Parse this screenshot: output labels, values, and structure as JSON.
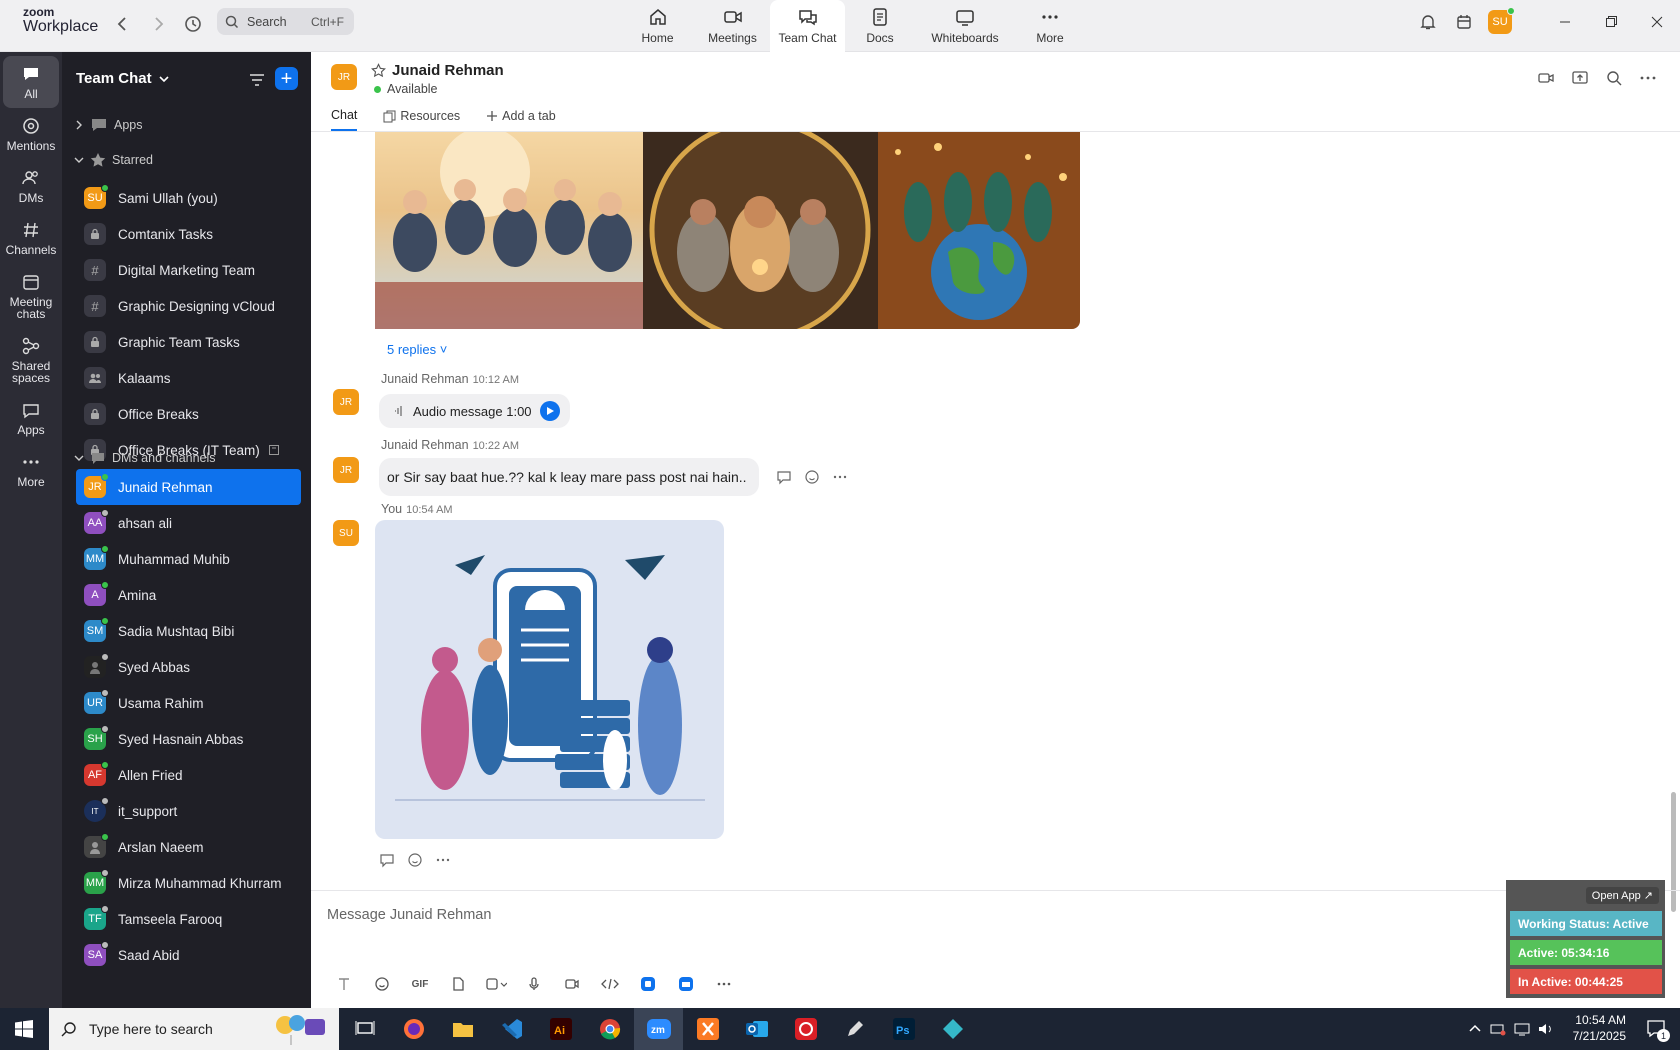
{
  "app": {
    "brand_small": "zoom",
    "brand_large": "Workplace"
  },
  "search": {
    "placeholder": "Search",
    "shortcut": "Ctrl+F"
  },
  "top_tabs": [
    {
      "label": "Home",
      "icon": "home-icon"
    },
    {
      "label": "Meetings",
      "icon": "video-icon"
    },
    {
      "label": "Team Chat",
      "icon": "chat-icon",
      "selected": true
    },
    {
      "label": "Docs",
      "icon": "doc-icon"
    },
    {
      "label": "Whiteboards",
      "icon": "whiteboard-icon"
    },
    {
      "label": "More",
      "icon": "more-icon"
    }
  ],
  "user": {
    "initials": "SU",
    "color": "#f29a16",
    "status_color": "#3ac34b"
  },
  "rail": [
    {
      "label": "All",
      "icon": "chat-bubble-icon",
      "selected": true
    },
    {
      "label": "Mentions",
      "icon": "at-icon"
    },
    {
      "label": "DMs",
      "icon": "people-icon"
    },
    {
      "label": "Channels",
      "icon": "hash-icon"
    },
    {
      "label": "Meeting chats",
      "icon": "calendar-icon"
    },
    {
      "label": "Shared spaces",
      "icon": "share-icon"
    },
    {
      "label": "Apps",
      "icon": "apps-icon"
    },
    {
      "label": "More",
      "icon": "more-icon"
    }
  ],
  "sidebar": {
    "title": "Team Chat",
    "sections": {
      "apps": "Apps",
      "starred": "Starred",
      "dms": "DMs and channels"
    },
    "starred": [
      {
        "name": "Sami Ullah (you)",
        "initials": "SU",
        "color": "#f29a16",
        "type": "avatar",
        "status": "#3ac34b"
      },
      {
        "name": "Comtanix Tasks",
        "type": "lock"
      },
      {
        "name": "Digital Marketing Team",
        "type": "hash"
      },
      {
        "name": "Graphic Designing vCloud",
        "type": "hash"
      },
      {
        "name": "Graphic Team Tasks",
        "type": "lock"
      },
      {
        "name": "Kalaams",
        "type": "group"
      },
      {
        "name": "Office Breaks",
        "type": "lock"
      },
      {
        "name": "Office Breaks (IT Team)",
        "type": "lock"
      }
    ],
    "dms": [
      {
        "name": "Junaid Rehman",
        "initials": "JR",
        "color": "#f29a16",
        "status": "#3ac34b",
        "selected": true
      },
      {
        "name": "ahsan ali",
        "initials": "AA",
        "color": "#8f4fbf",
        "status": "#bbb"
      },
      {
        "name": "Muhammad Muhib",
        "initials": "MM",
        "color": "#2d8ac9",
        "status": "#3ac34b"
      },
      {
        "name": "Amina",
        "initials": "A",
        "color": "#8f4fbf",
        "status": "#3ac34b"
      },
      {
        "name": "Sadia Mushtaq Bibi",
        "initials": "SM",
        "color": "#2d8ac9",
        "status": "#3ac34b"
      },
      {
        "name": "Syed Abbas",
        "initials": "",
        "color": "#222",
        "status": "#bbb"
      },
      {
        "name": "Usama Rahim",
        "initials": "UR",
        "color": "#2d8ac9",
        "status": "#bbb"
      },
      {
        "name": "Syed Hasnain Abbas",
        "initials": "SH",
        "color": "#2aa24a",
        "status": "#bbb"
      },
      {
        "name": "Allen Fried",
        "initials": "AF",
        "color": "#d6382f",
        "status": "#3ac34b"
      },
      {
        "name": "it_support",
        "initials": "IT",
        "color": "#1b2f5a",
        "status": "#bbb"
      },
      {
        "name": "Arslan Naeem",
        "initials": "",
        "color": "#444",
        "status": "#3ac34b"
      },
      {
        "name": "Mirza Muhammad Khurram",
        "initials": "MM",
        "color": "#2aa24a",
        "status": "#bbb"
      },
      {
        "name": "Tamseela Farooq",
        "initials": "TF",
        "color": "#1aa58a",
        "status": "#bbb"
      },
      {
        "name": "Saad Abid",
        "initials": "SA",
        "color": "#8f4fbf",
        "status": "#bbb"
      }
    ]
  },
  "chat": {
    "contact": {
      "name": "Junaid Rehman",
      "initials": "JR",
      "status": "Available",
      "color": "#f29a16"
    },
    "tabs": [
      "Chat",
      "Resources",
      "Add a tab"
    ],
    "replies": "5 replies",
    "messages": [
      {
        "sender": "Junaid Rehman",
        "time": "10:12 AM",
        "initials": "JR",
        "text": "Audio message 1:00"
      },
      {
        "sender": "Junaid Rehman",
        "time": "10:22 AM",
        "initials": "JR",
        "text": "or Sir say baat hue.?? kal k leay mare pass post nai hain.."
      },
      {
        "sender": "You",
        "time": "10:54 AM",
        "initials": "SU",
        "text": ""
      }
    ],
    "composer_placeholder": "Message Junaid Rehman"
  },
  "widget": {
    "open_app": "Open App ↗",
    "working_status": "Working Status: Active",
    "active": "Active: 05:34:16",
    "inactive": "In Active: 00:44:25",
    "colors": {
      "status": "#58b6c5",
      "active": "#56c25a",
      "inactive": "#e25248"
    }
  },
  "taskbar": {
    "search_placeholder": "Type here to search",
    "time": "10:54 AM",
    "date": "7/21/2025",
    "notifications": "1"
  }
}
